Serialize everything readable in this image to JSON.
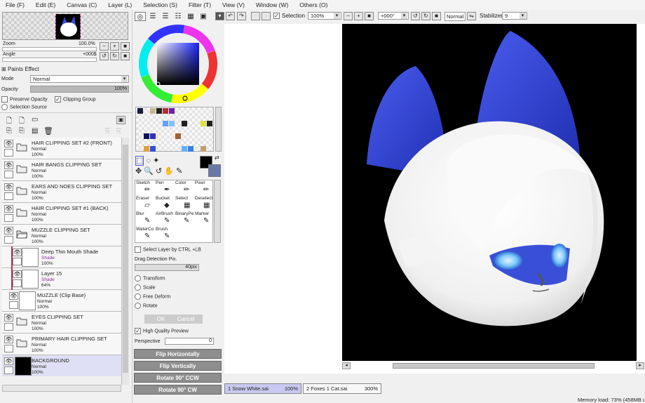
{
  "menu": [
    "File (F)",
    "Edit (E)",
    "Canvas (C)",
    "Layer (L)",
    "Selection (S)",
    "Filter (T)",
    "View (V)",
    "Window (W)",
    "Others (O)"
  ],
  "navigator": {
    "zoom_label": "Zoom",
    "zoom_value": "100.0%",
    "angle_label": "Angle",
    "angle_value": "+000$"
  },
  "paint_effect": {
    "title": "Paints Effect",
    "mode_label": "Mode",
    "mode_value": "Normal",
    "opacity_label": "Opacity",
    "opacity_value": "100%",
    "preserve_opacity": "Preserve Opacity",
    "clipping_group": "Clipping Group",
    "selection_source": "Selection Source"
  },
  "layers": [
    {
      "name": "HAIR CLIPPING SET #2 (FRONT)",
      "mode": "Normal",
      "opacity": "100%",
      "kind": "folder"
    },
    {
      "name": "HAIR BANGS CLIPPING SET",
      "mode": "Normal",
      "opacity": "100%",
      "kind": "folder"
    },
    {
      "name": "EARS AND NOES CLIPPING SET",
      "mode": "Normal",
      "opacity": "100%",
      "kind": "folder"
    },
    {
      "name": "HAIR CLIPPING SET #1 (BACK)",
      "mode": "Normal",
      "opacity": "100%",
      "kind": "folder"
    },
    {
      "name": "MUZZLE CLIPPING SET",
      "mode": "Normal",
      "opacity": "100%",
      "kind": "folder"
    },
    {
      "name": "Deep Thin Mouth Shade",
      "mode": "Shade",
      "opacity": "100%",
      "kind": "clip"
    },
    {
      "name": "Layer 15",
      "mode": "Shade",
      "opacity": "64%",
      "kind": "clip"
    },
    {
      "name": "MUZZLE (Clip Base)",
      "mode": "Normal",
      "opacity": "100%",
      "kind": "base"
    },
    {
      "name": "EYES CLIPPING SET",
      "mode": "Normal",
      "opacity": "100%",
      "kind": "folder"
    },
    {
      "name": "PRIMARY HAIR CLIPPING SET",
      "mode": "Normal",
      "opacity": "100%",
      "kind": "folder"
    },
    {
      "name": "BACKGROUND",
      "mode": "Normal",
      "opacity": "100%",
      "kind": "bg"
    }
  ],
  "brushes": [
    [
      "Sketch",
      "Pen",
      "Color",
      "Pixel"
    ],
    [
      "Eraser",
      "Bucket",
      "Select",
      "Deselect"
    ],
    [
      "Blur",
      "AirBrush",
      "BinaryPe",
      "Marker"
    ],
    [
      "WaterCo",
      "Brush",
      "",
      ""
    ]
  ],
  "tool_options": {
    "select_layer": "Select Layer by CTRL +LB",
    "drag_detection": "Drag Detection Pix.",
    "drag_value": "40pix",
    "transform": "Transform",
    "scale": "Scale",
    "free_deform": "Free Deform",
    "rotate": "Rotate",
    "ok": "OK",
    "cancel": "Cancel",
    "hq_preview": "High Quality Preview",
    "perspective": "Perspective",
    "perspective_value": "0",
    "flip_h": "Flip Horizontally",
    "flip_v": "Flip Vertically",
    "rot_ccw": "Rotate 90° CCW",
    "rot_cw": "Rotate 90° CW"
  },
  "toolbar": {
    "selection": "Selection",
    "zoom": "100%",
    "angle": "+000°",
    "blend": "Normal",
    "stabilizer_label": "Stabilizer",
    "stabilizer_value": "9"
  },
  "tabs": [
    {
      "name": "1 Snow White.sai",
      "zoom": "100%"
    },
    {
      "name": "2 Foxes 1 Cat.sai",
      "zoom": "300%"
    }
  ],
  "status": {
    "memory": "Memory load: 73% (458MB u"
  },
  "colors": {
    "accent": "#3a4fd8",
    "fur": "#ffffff",
    "bg": "#000000"
  }
}
